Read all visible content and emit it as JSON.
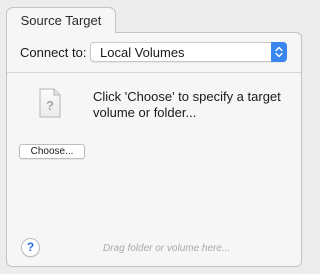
{
  "tab": {
    "label": "Source Target"
  },
  "connect": {
    "label": "Connect to:",
    "selected": "Local Volumes",
    "stepper_icon": "up-down-chevron-icon",
    "accent": "#3a86f0"
  },
  "target": {
    "icon": "unknown-document-icon",
    "instruction": "Click 'Choose' to specify a target volume or folder..."
  },
  "choose_button": {
    "label": "Choose..."
  },
  "help_button": {
    "label": "?"
  },
  "drop_hint": "Drag folder or volume here..."
}
